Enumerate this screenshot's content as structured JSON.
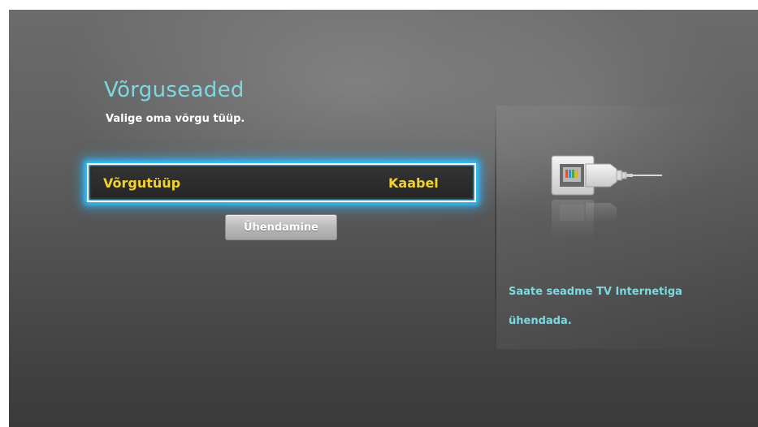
{
  "header": {
    "title": "Võrguseaded",
    "subtitle": "Valige oma võrgu tüüp."
  },
  "settings": {
    "network_type_label": "Võrgutüüp",
    "network_type_value": "Kaabel"
  },
  "actions": {
    "connect_label": "Ühendamine"
  },
  "help": {
    "line1": "Saate seadme TV Internetiga",
    "line2": "ühendada."
  },
  "icons": {
    "cable": "ethernet-cable-icon"
  },
  "colors": {
    "title": "#7ed8e0",
    "highlight_text": "#f2d22c",
    "focus_glow": "#2fc6ff"
  }
}
